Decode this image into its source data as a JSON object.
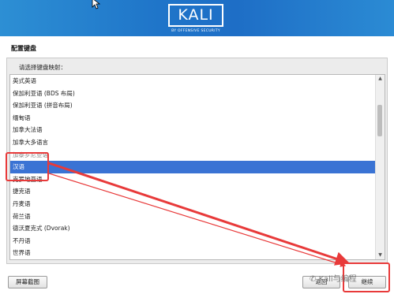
{
  "header": {
    "logo_text": "KALI",
    "logo_subtitle": "BY OFFENSIVE SECURITY",
    "banner_color": "#1f75c9"
  },
  "page": {
    "title": "配置键盘",
    "prompt": "请选择键盘映射："
  },
  "keymap_list": {
    "items": [
      "英式英语",
      "保加利亚语 (BDS 布局)",
      "保加利亚语 (拼音布局)",
      "缅甸语",
      "加拿大法语",
      "加拿大多语言",
      "加泰罗尼亚语",
      "汉语",
      "克罗地亚语",
      "捷克语",
      "丹麦语",
      "荷兰语",
      "德沃夏克式 (Dvorak)",
      "不丹语",
      "世界语"
    ],
    "selected": "汉语",
    "selection_color": "#3a73d4"
  },
  "buttons": {
    "screenshot": "屏幕截图",
    "back": "返回",
    "continue": "继续"
  },
  "annotations": {
    "highlight_color": "#e83a3a"
  },
  "watermark": "Kali与编程"
}
